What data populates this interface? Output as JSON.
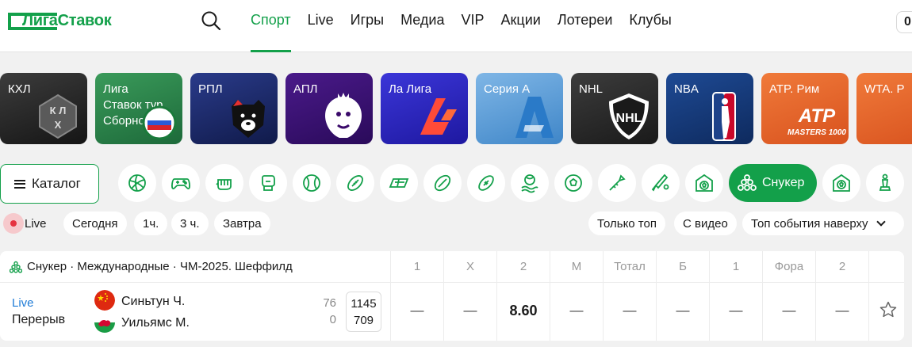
{
  "header": {
    "logo_text": "ЛигаСтавок",
    "nav": [
      {
        "label": "Спорт",
        "active": true
      },
      {
        "label": "Live"
      },
      {
        "label": "Игры"
      },
      {
        "label": "Медиа"
      },
      {
        "label": "VIP"
      },
      {
        "label": "Акции"
      },
      {
        "label": "Лотереи"
      },
      {
        "label": "Клубы"
      }
    ],
    "balance": "0"
  },
  "leagues": [
    {
      "label": "КХЛ",
      "icon": "khl-logo-icon",
      "color": "#2a2a2a"
    },
    {
      "label": "Лига\nСтавок тур\nСборной",
      "icon": "national-team-tour-icon",
      "color": "#2a7a4a"
    },
    {
      "label": "РПЛ",
      "icon": "rpl-bear-icon",
      "color": "#1e2a6a"
    },
    {
      "label": "АПЛ",
      "icon": "premier-league-lion-icon",
      "color": "#3a1a6a"
    },
    {
      "label": "Ла Лига",
      "icon": "laliga-icon",
      "color": "#2a24b8"
    },
    {
      "label": "Серия А",
      "icon": "serie-a-icon",
      "color": "#5aa0d8"
    },
    {
      "label": "NHL",
      "icon": "nhl-shield-icon",
      "color": "#2b2b2b"
    },
    {
      "label": "NBA",
      "icon": "nba-logo-icon",
      "color": "#16336e"
    },
    {
      "label": "ATP. Рим",
      "icon": "atp-masters-icon",
      "color": "#e8642a",
      "art_text": "ATP",
      "art_sub": "MASTERS 1000"
    },
    {
      "label": "WTA. Р",
      "icon": "wta-icon",
      "color": "#e8642a"
    }
  ],
  "catalog": {
    "label": "Каталог"
  },
  "sports": [
    {
      "name": "volleyball-icon"
    },
    {
      "name": "esports-gamepad-icon"
    },
    {
      "name": "hockey-glove-icon"
    },
    {
      "name": "boxing-icon"
    },
    {
      "name": "baseball-icon"
    },
    {
      "name": "rugby-ball-icon"
    },
    {
      "name": "floorball-icon"
    },
    {
      "name": "aussie-rules-icon"
    },
    {
      "name": "american-football-icon"
    },
    {
      "name": "water-polo-icon"
    },
    {
      "name": "futsal-icon"
    },
    {
      "name": "darts-icon"
    },
    {
      "name": "cricket-icon"
    },
    {
      "name": "beach-soccer-icon"
    },
    {
      "name": "snooker-icon",
      "label": "Снукер",
      "active": true
    },
    {
      "name": "field-soccer-icon"
    },
    {
      "name": "chess-icon"
    }
  ],
  "filters": {
    "live": "Live",
    "today": "Сегодня",
    "h1": "1ч.",
    "h3": "3 ч.",
    "tomorrow": "Завтра",
    "top_only": "Только топ",
    "with_video": "С видео",
    "sort": "Топ события наверху"
  },
  "table": {
    "tournament": "Снукер · Международные · ЧМ-2025. Шеффилд",
    "columns": [
      "1",
      "X",
      "2",
      "М",
      "Тотал",
      "Б",
      "1",
      "Фора",
      "2"
    ],
    "event": {
      "live_label": "Live",
      "status": "Перерыв",
      "team1": "Синьтун Ч.",
      "team2": "Уильямс М.",
      "score1": "76",
      "score2": "0",
      "total1": "1145",
      "total2": "709",
      "odds": [
        "—",
        "—",
        "8.60",
        "—",
        "—",
        "—",
        "—",
        "—",
        "—"
      ]
    }
  }
}
